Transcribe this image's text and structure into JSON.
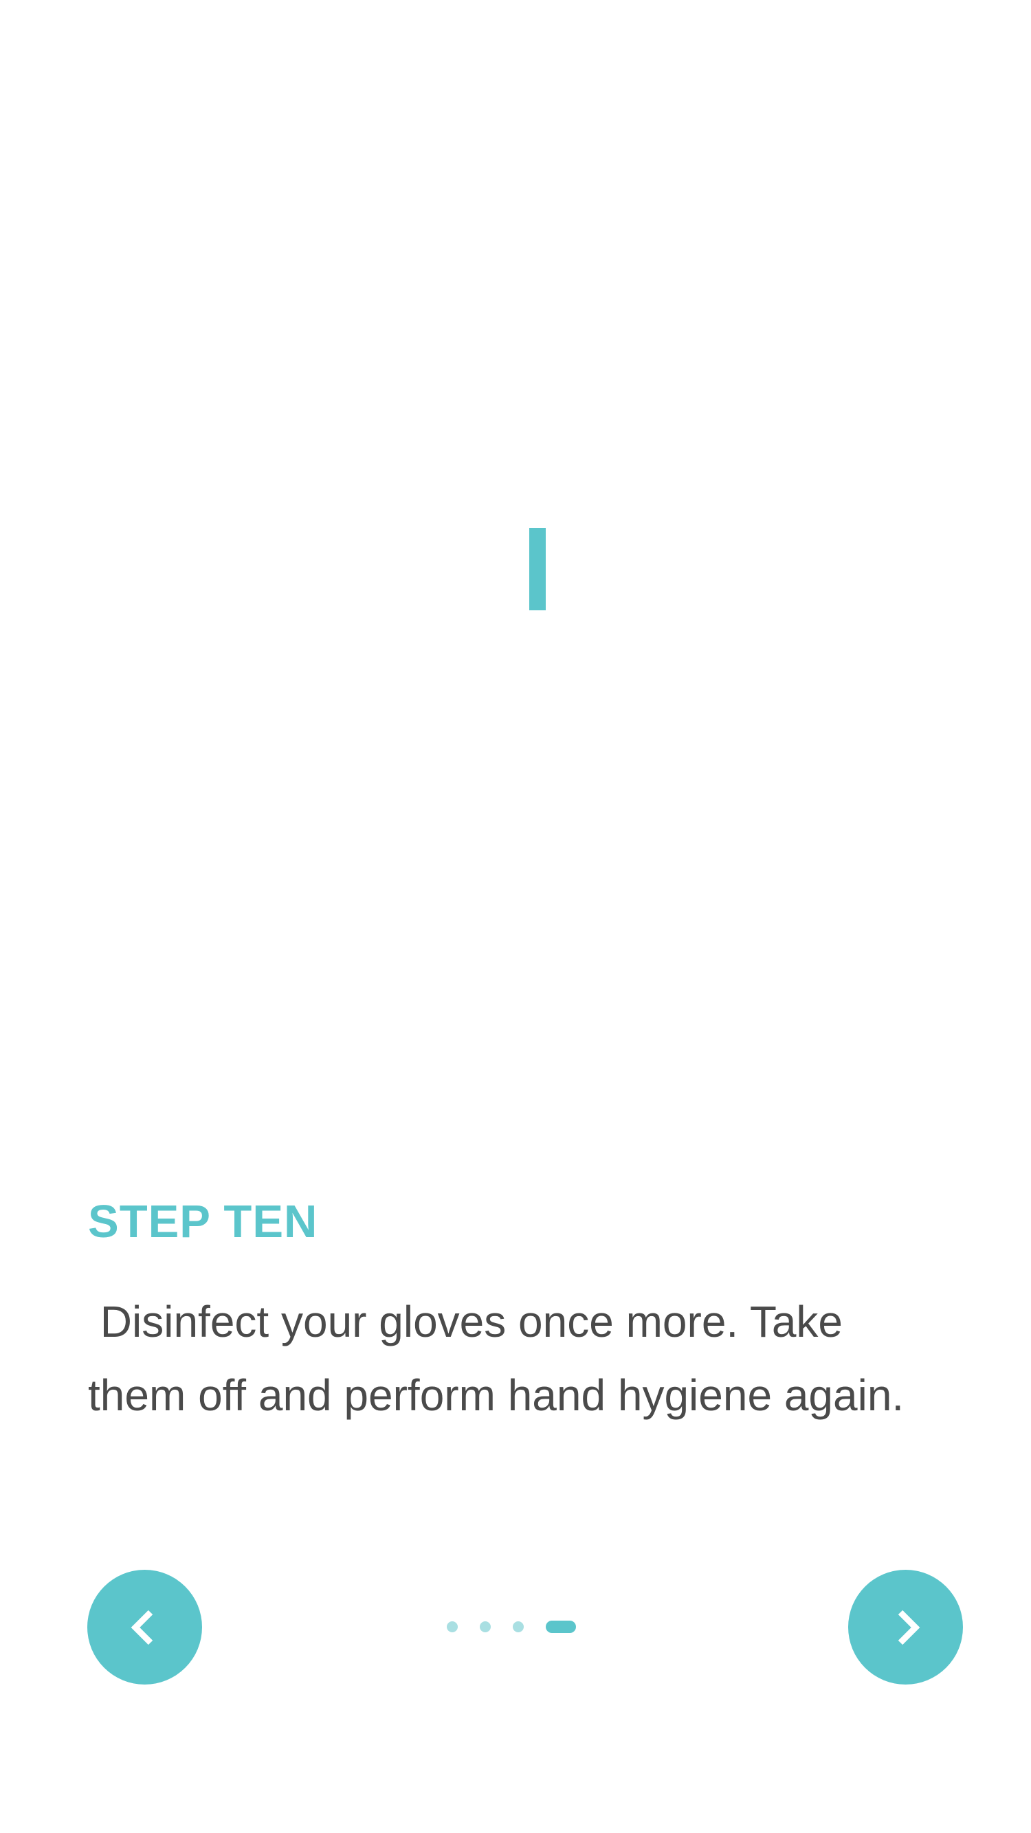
{
  "theme": {
    "accent": "#5bc5cb",
    "accent_light": "#a9dfe2",
    "text": "#4a4a4a",
    "background": "#ffffff"
  },
  "content": {
    "step_label": "STEP TEN",
    "description": " Disinfect your gloves once more. Take them off and perform hand hygiene again."
  },
  "navigation": {
    "prev_icon": "chevron-left-icon",
    "next_icon": "chevron-right-icon",
    "pager": {
      "total_visible": 4,
      "active_index": 3
    }
  },
  "media": {
    "loading_indicator": "loading-bar-icon"
  }
}
